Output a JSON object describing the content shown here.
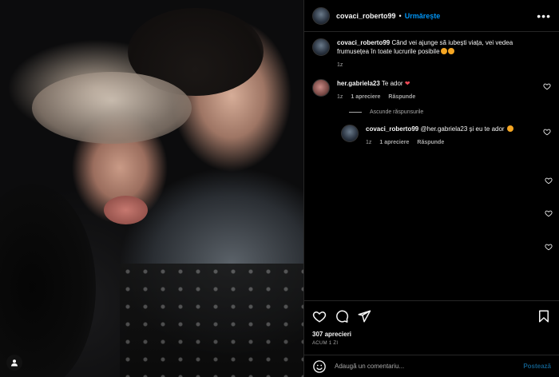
{
  "post": {
    "username": "covaci_roberto99",
    "follow_label": "Urmărește",
    "more_label": "•••"
  },
  "comments": {
    "caption": {
      "username": "covaci_roberto99",
      "text": "Când vei ajunge să iubești viața, vei vedea frumusețea în toate lucrurile posibile",
      "time": "1z"
    },
    "items": [
      {
        "username": "her.gabriela23",
        "text": "Te ador",
        "time": "1z",
        "likes": "1 apreciere",
        "reply_label": "Răspunde"
      }
    ],
    "hide_replies_label": "Ascunde răspunsurile",
    "reply": {
      "username": "covaci_roberto99",
      "text": "@her.gabriela23 și eu te ador",
      "time": "1z",
      "likes": "1 apreciere",
      "reply_label": "Răspunde"
    }
  },
  "footer": {
    "likes_count": "307 aprecieri",
    "time_ago": "ACUM 1 ZI",
    "comment_placeholder": "Adaugă un comentariu...",
    "post_label": "Postează"
  },
  "colors": {
    "accent": "#0095f6",
    "post_disabled": "#115a85",
    "muted": "#a8a8a8",
    "background": "#000000"
  },
  "icons": [
    "heart-icon",
    "comment-icon",
    "share-icon",
    "bookmark-icon",
    "emoji-icon",
    "user-tag-icon",
    "more-icon"
  ]
}
